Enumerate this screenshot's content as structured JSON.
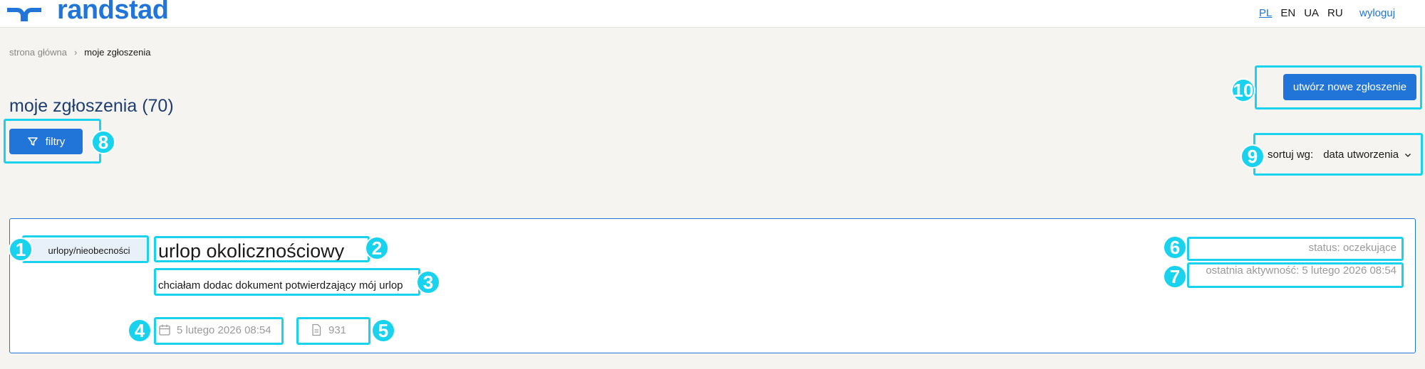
{
  "header": {
    "brand": "randstad",
    "languages": [
      "PL",
      "EN",
      "UA",
      "RU"
    ],
    "active_language": "PL",
    "logout": "wyloguj"
  },
  "breadcrumb": {
    "home": "strona główna",
    "separator": "›",
    "current": "moje zgłoszenia"
  },
  "page": {
    "title": "moje zgłoszenia (70)",
    "create_button": "utwórz nowe zgłoszenie",
    "filters_button": "filtry",
    "sort_label": "sortuj wg:",
    "sort_value": "data utworzenia"
  },
  "requests": [
    {
      "category": "urlopy/nieobecności",
      "title": "urlop okolicznościowy",
      "description": "chciałam dodac dokument potwierdzający mój urlop",
      "created": "5 lutego 2026 08:54",
      "id": "931",
      "status": "status: oczekujące",
      "last_activity": "ostatnia aktywność: 5 lutego 2026 08:54"
    }
  ],
  "annotations": [
    "1",
    "2",
    "3",
    "4",
    "5",
    "6",
    "7",
    "8",
    "9",
    "10"
  ],
  "colors": {
    "accent": "#2175d9",
    "title": "#1f3e70",
    "highlight": "#18d2ee",
    "background": "#f5f4f0"
  }
}
